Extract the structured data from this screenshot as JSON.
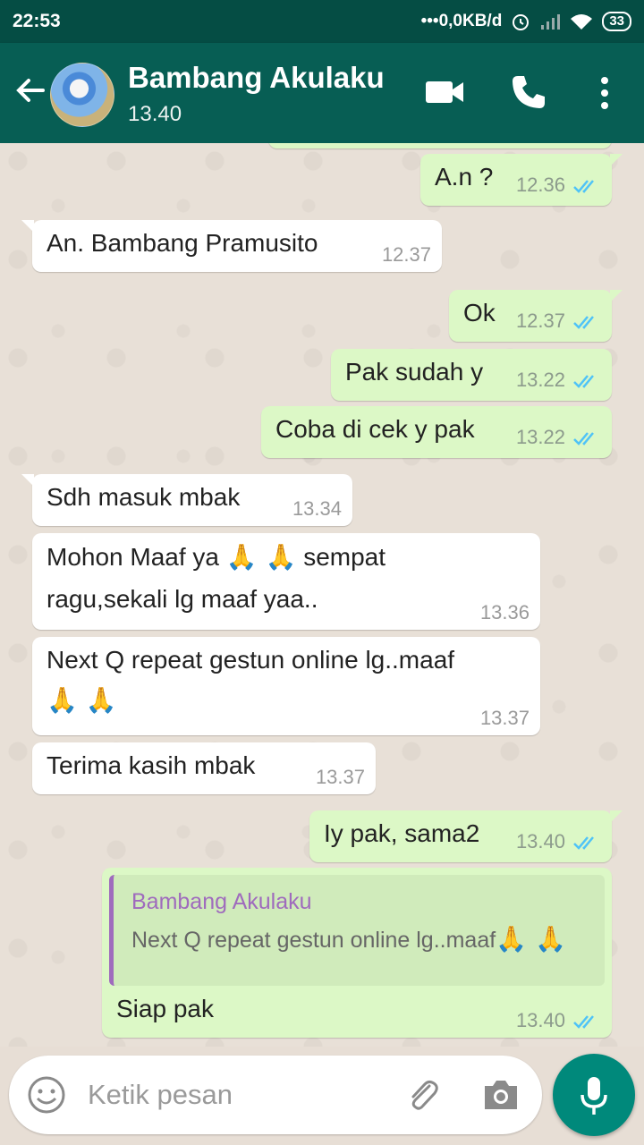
{
  "status_bar": {
    "time": "22:53",
    "network": "•••0,0KB/d",
    "battery": "33"
  },
  "header": {
    "contact_name": "Bambang Akulaku",
    "last_seen": "13.40"
  },
  "messages": [
    {
      "direction": "out",
      "text": "A.n ?",
      "time": "12.36",
      "read": true
    },
    {
      "direction": "in",
      "text": "An. Bambang Pramusito",
      "time": "12.37"
    },
    {
      "direction": "out",
      "text": "Ok",
      "time": "12.37",
      "read": true
    },
    {
      "direction": "out",
      "text": "Pak sudah y",
      "time": "13.22",
      "read": true
    },
    {
      "direction": "out",
      "text": "Coba di cek y pak",
      "time": "13.22",
      "read": true
    },
    {
      "direction": "in",
      "text": "Sdh masuk mbak",
      "time": "13.34"
    },
    {
      "direction": "in",
      "text_line1": "Mohon Maaf ya",
      "text_line1_after": "sempat",
      "text_line2": "ragu,sekali lg maaf yaa..",
      "time": "13.36"
    },
    {
      "direction": "in",
      "text_line1": "Next Q repeat gestun online lg..maaf",
      "time": "13.37"
    },
    {
      "direction": "in",
      "text": "Terima kasih mbak",
      "time": "13.37"
    },
    {
      "direction": "out",
      "text": "Iy pak, sama2",
      "time": "13.40",
      "read": true
    },
    {
      "direction": "out",
      "quote_name": "Bambang Akulaku",
      "quote_text": "Next Q repeat gestun online lg..maaf",
      "text": "Siap pak",
      "time": "13.40",
      "read": true
    }
  ],
  "composer": {
    "placeholder": "Ketik pesan"
  },
  "icons": {
    "back": "arrow-left",
    "video": "video-call",
    "call": "phone",
    "menu": "more-vertical",
    "emoji": "smiley",
    "attach": "paperclip",
    "camera": "camera",
    "mic": "microphone",
    "emoji_in_text": "folded-hands"
  },
  "colors": {
    "header": "#075e54",
    "status_bar": "#054d44",
    "outgoing": "#dcf8c6",
    "incoming": "#ffffff",
    "read_ticks": "#4fc3f7",
    "fab": "#00897b",
    "quote_accent": "#9f6bbd"
  }
}
